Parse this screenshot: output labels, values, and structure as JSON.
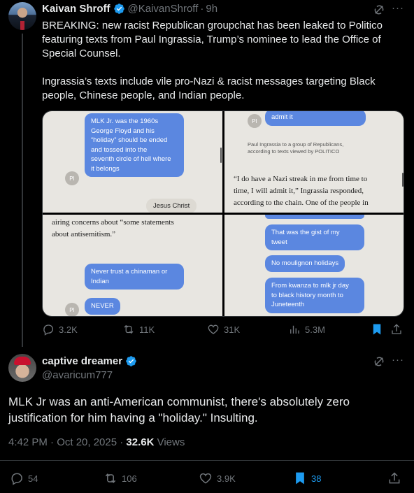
{
  "tweet": {
    "name": "Kaivan Shroff",
    "handle": "@KaivanShroff",
    "time": "9h",
    "text_line1": "BREAKING: new racist Republican groupchat has been leaked to Politico",
    "text_line2": "featuring texts from Paul Ingrassia, Trump’s nominee to lead the Office of",
    "text_line3": "Special Counsel.",
    "text_line4": "Ingrassia’s texts include vile pro-Nazi & racist messages targeting Black",
    "text_line5": "people, Chinese people, and Indian people.",
    "actions": {
      "replies": "3.2K",
      "reposts": "11K",
      "likes": "31K",
      "views": "5.3M"
    }
  },
  "media": {
    "panel1": {
      "bubble_line1": "MLK Jr. was the 1960s",
      "bubble_line2": "George Floyd and his",
      "bubble_line3": "“holiday” should be ended",
      "bubble_line4": "and tossed into the",
      "bubble_line5": "seventh circle of hell where",
      "bubble_line6": "it belongs",
      "avatar": "PI",
      "reply": "Jesus Christ"
    },
    "panel2": {
      "bubble": "admit it",
      "avatar": "PI",
      "caption_line1": "Paul Ingrassia to a group of Republicans,",
      "caption_line2": "according to texts viewed by POLITICO",
      "quote_line1": "“I do have a Nazi streak in me from time to",
      "quote_line2": "time, I will admit it,” Ingrassia responded,",
      "quote_line3": "according to the chain. One of the people in"
    },
    "panel3": {
      "quote_line1": "airing concerns about “some statements",
      "quote_line2": "about antisemitism.”",
      "bubble1_line1": "Never trust a chinaman or",
      "bubble1_line2": "Indian",
      "bubble2": "NEVER",
      "avatar": "PI"
    },
    "panel4": {
      "bubble1_line1": "That was the gist of my",
      "bubble1_line2": "tweet",
      "bubble2": "No moulignon holidays",
      "bubble3_line1": "From kwanza to mlk jr day",
      "bubble3_line2": "to black history month to",
      "bubble3_line3": "Juneteenth"
    }
  },
  "reply": {
    "name": "captive dreamer",
    "handle": "@avaricum777",
    "text_line1": "MLK Jr was an anti-American communist, there's absolutely zero",
    "text_line2": "justification for him having a \"holiday.\"  Insulting.",
    "timestamp": "4:42 PM · Oct 20, 2025 · ",
    "views_count": "32.6K",
    "views_label": " Views",
    "actions": {
      "replies": "54",
      "reposts": "106",
      "likes": "3.9K",
      "bookmarks": "38"
    }
  },
  "colors": {
    "background": "#000000",
    "text": "#e7e9ea",
    "muted": "#71767b",
    "verified": "#1d9bf0",
    "bookmark_active": "#1d9bf0",
    "bubble": "#5b87e0"
  }
}
